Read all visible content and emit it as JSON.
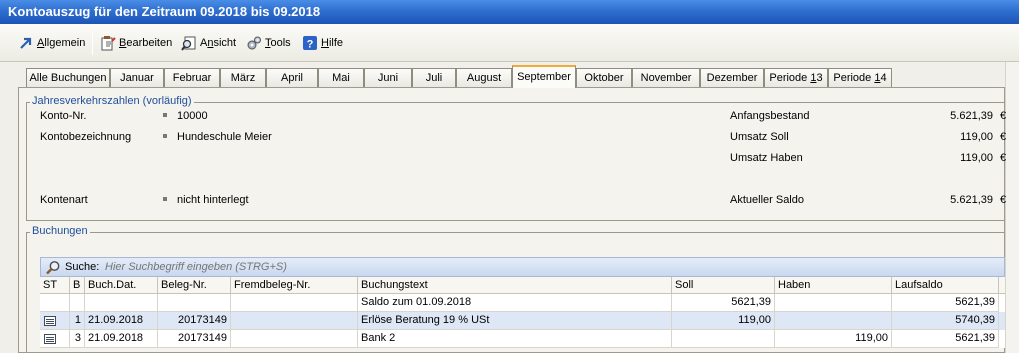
{
  "window": {
    "title": "Kontoauszug für den Zeitraum 09.2018 bis 09.2018"
  },
  "menu": [
    {
      "label": "Allgemein",
      "key": "A",
      "icon": "arrow-icon"
    },
    {
      "label": "Bearbeiten",
      "key": "B",
      "icon": "edit-icon"
    },
    {
      "label": "Ansicht",
      "key": "n",
      "icon": "view-icon"
    },
    {
      "label": "Tools",
      "key": "T",
      "icon": "gears-icon"
    },
    {
      "label": "Hilfe",
      "key": "H",
      "icon": "help-icon"
    }
  ],
  "tabs": [
    "Alle Buchungen",
    "Januar",
    "Februar",
    "März",
    "April",
    "Mai",
    "Juni",
    "Juli",
    "August",
    "September",
    "Oktober",
    "November",
    "Dezember",
    "Periode 13",
    "Periode 14"
  ],
  "active_tab": "September",
  "jahres": {
    "group_label": "Jahresverkehrszahlen (vorläufig)",
    "konto_nr_label": "Konto-Nr.",
    "konto_nr": "10000",
    "bezeichnung_label": "Kontobezeichnung",
    "bezeichnung": "Hundeschule Meier",
    "kontenart_label": "Kontenart",
    "kontenart": "nicht hinterlegt",
    "anfangsbestand_label": "Anfangsbestand",
    "anfangsbestand": "5.621,39",
    "umsatz_soll_label": "Umsatz Soll",
    "umsatz_soll": "119,00",
    "umsatz_haben_label": "Umsatz Haben",
    "umsatz_haben": "119,00",
    "saldo_label": "Aktueller Saldo",
    "saldo": "5.621,39",
    "currency": "€"
  },
  "buchungen": {
    "group_label": "Buchungen",
    "search_label": "Suche:",
    "search_placeholder": "Hier Suchbegriff eingeben (STRG+S)",
    "columns": [
      "ST",
      "B",
      "Buch.Dat.",
      "Beleg-Nr.",
      "Fremdbeleg-Nr.",
      "Buchungstext",
      "Soll",
      "Haben",
      "Laufsaldo"
    ],
    "rows": [
      {
        "st": "",
        "b": "",
        "datum": "",
        "beleg": "",
        "fremd": "",
        "text": "Saldo zum 01.09.2018",
        "soll": "5621,39",
        "haben": "",
        "lauf": "5621,39"
      },
      {
        "st": "doc",
        "b": "1",
        "datum": "21.09.2018",
        "beleg": "20173149",
        "fremd": "",
        "text": "Erlöse Beratung 19 % USt",
        "soll": "119,00",
        "haben": "",
        "lauf": "5740,39"
      },
      {
        "st": "doc",
        "b": "3",
        "datum": "21.09.2018",
        "beleg": "20173149",
        "fremd": "",
        "text": "Bank 2",
        "soll": "",
        "haben": "119,00",
        "lauf": "5621,39"
      }
    ]
  },
  "colors": {
    "title_bar": "#2f6fd0",
    "active_tab_accent": "#f2a93b",
    "group_label": "#1f4e9a",
    "row_highlight": "#dde7f5"
  }
}
